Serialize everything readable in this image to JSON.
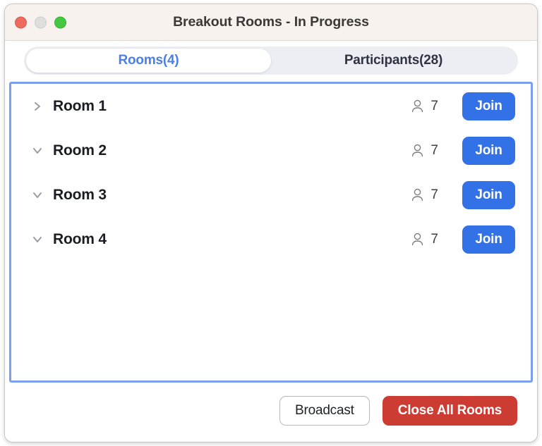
{
  "window": {
    "title": "Breakout Rooms - In Progress",
    "traffic_lights": [
      {
        "name": "close",
        "color": "#ed6a5e"
      },
      {
        "name": "minimize",
        "color": "#dedede"
      },
      {
        "name": "zoom",
        "color": "#44c741"
      }
    ]
  },
  "tabs": [
    {
      "label": "Rooms(4)",
      "active": true
    },
    {
      "label": "Participants(28)",
      "active": false
    }
  ],
  "rooms": [
    {
      "name": "Room 1",
      "expanded": false,
      "participants": "7",
      "join_label": "Join"
    },
    {
      "name": "Room 2",
      "expanded": true,
      "participants": "7",
      "join_label": "Join"
    },
    {
      "name": "Room 3",
      "expanded": true,
      "participants": "7",
      "join_label": "Join"
    },
    {
      "name": "Room 4",
      "expanded": true,
      "participants": "7",
      "join_label": "Join"
    }
  ],
  "footer": {
    "broadcast_label": "Broadcast",
    "close_all_label": "Close All Rooms"
  },
  "colors": {
    "accent_blue": "#3271e6",
    "tab_active_text": "#4a7fe8",
    "list_border": "#7c9eee",
    "danger_red": "#cd3c33",
    "titlebar_bg": "#f7f2ed"
  },
  "icons": {
    "person": "person-icon",
    "chevron_right": "chevron-right-icon",
    "chevron_down": "chevron-down-icon"
  }
}
